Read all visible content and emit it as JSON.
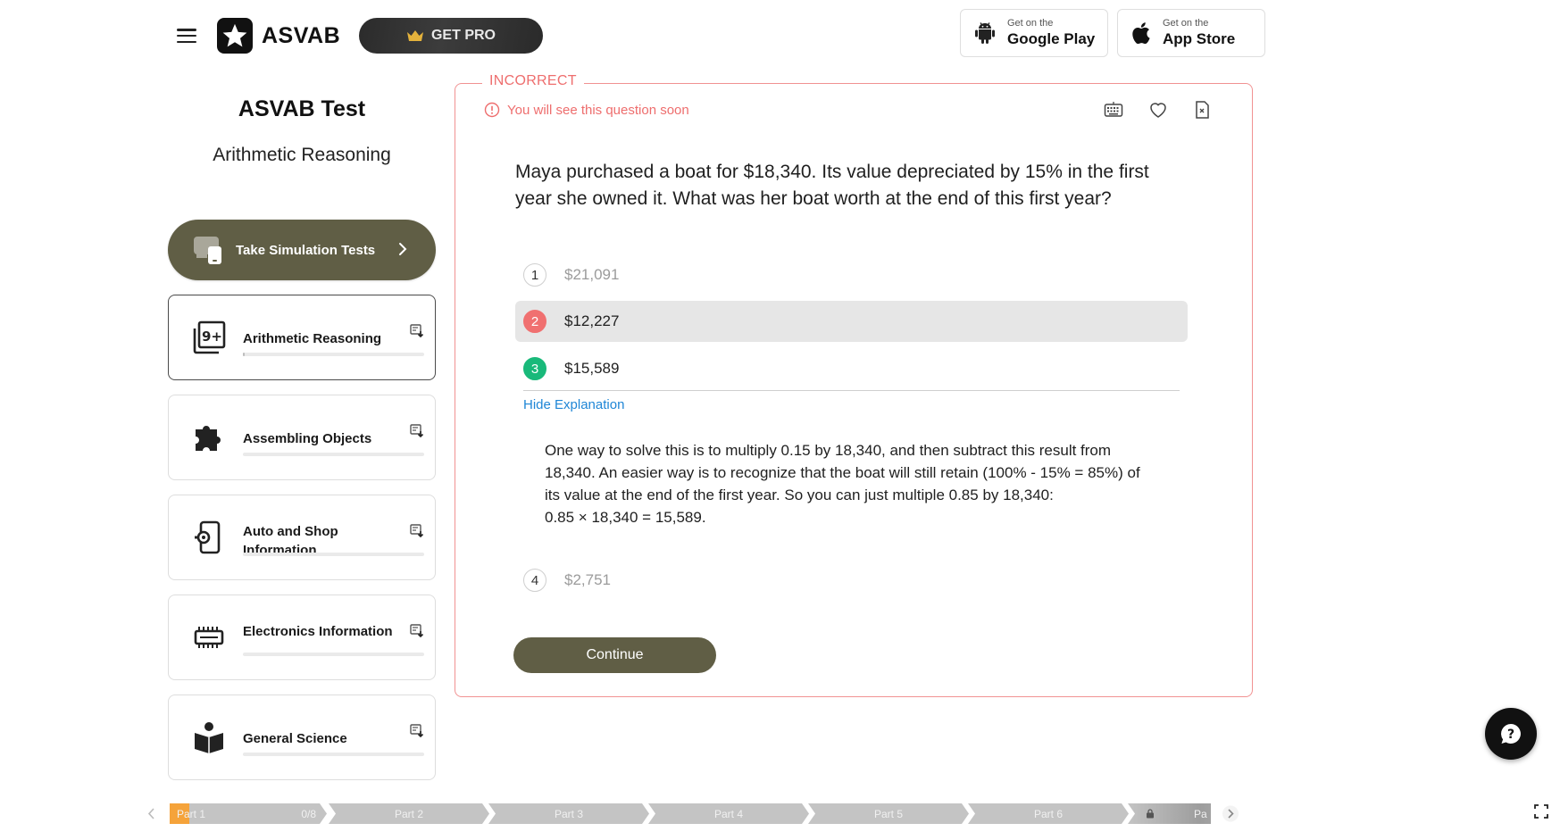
{
  "header": {
    "logo_text": "ASVAB",
    "get_pro_label": "GET PRO",
    "google_play": {
      "small": "Get on the",
      "big": "Google Play"
    },
    "app_store": {
      "small": "Get on the",
      "big": "App Store"
    }
  },
  "sidebar": {
    "title": "ASVAB Test",
    "subtitle": "Arithmetic Reasoning",
    "simulation_label": "Take Simulation Tests",
    "subjects": [
      {
        "label": "Arithmetic Reasoning",
        "icon": "numbers-icon",
        "active": true,
        "progress": 0.01
      },
      {
        "label": "Assembling Objects",
        "icon": "puzzle-icon",
        "active": false,
        "progress": 0
      },
      {
        "label": "Auto and Shop Information",
        "icon": "car-settings-icon",
        "active": false,
        "progress": 0
      },
      {
        "label": "Electronics Information",
        "icon": "chip-icon",
        "active": false,
        "progress": 0
      },
      {
        "label": "General Science",
        "icon": "science-book-icon",
        "active": false,
        "progress": 0
      }
    ]
  },
  "question": {
    "status": "INCORRECT",
    "notice": "You will see this question soon",
    "text": "Maya purchased a boat for $18,340. Its value depreciated by 15% in the first year she owned it. What was her boat worth at the end of this first year?",
    "options": [
      {
        "num": "1",
        "value": "$21,091",
        "state": "none"
      },
      {
        "num": "2",
        "value": "$12,227",
        "state": "wrong"
      },
      {
        "num": "3",
        "value": "$15,589",
        "state": "correct"
      },
      {
        "num": "4",
        "value": "$2,751",
        "state": "none"
      }
    ],
    "hide_explanation_label": "Hide Explanation",
    "explanation_lines": [
      "One way to solve this is to multiply 0.15 by 18,340, and then subtract this result from",
      "18,340. An easier way is to recognize that the boat will still retain (100% - 15% = 85%) of",
      "its value at the end of the first year. So you can just multiple 0.85 by 18,340:",
      "0.85 × 18,340 = 15,589."
    ],
    "continue_label": "Continue"
  },
  "parts": [
    {
      "label": "Part 1",
      "count": "0/8"
    },
    {
      "label": "Part 2"
    },
    {
      "label": "Part 3"
    },
    {
      "label": "Part 4"
    },
    {
      "label": "Part 5"
    },
    {
      "label": "Part 6"
    },
    {
      "label": "Pa",
      "locked": true
    }
  ],
  "colors": {
    "accent": "#605e45",
    "incorrect": "#ee6e6e",
    "correct": "#19b97a",
    "link": "#1f86d6",
    "progress_start": "#f5a33a"
  }
}
